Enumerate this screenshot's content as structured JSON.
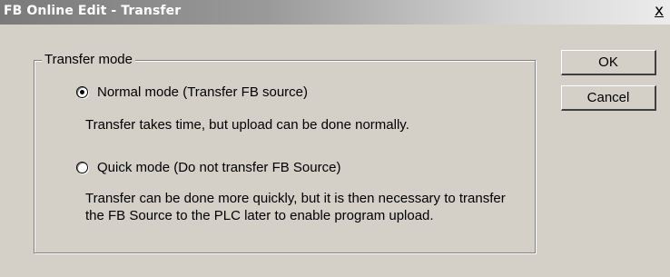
{
  "window": {
    "title": "FB Online Edit - Transfer",
    "close_label": "x"
  },
  "group": {
    "legend": "Transfer mode"
  },
  "options": [
    {
      "label": "Normal mode (Transfer FB source)",
      "description": "Transfer takes time, but upload can be done normally.",
      "checked": true
    },
    {
      "label": "Quick mode (Do not transfer FB Source)",
      "description_line1": "Transfer can be done more quickly, but it is then necessary to transfer",
      "description_line2": "the FB Source to the PLC later to enable program upload.",
      "checked": false
    }
  ],
  "buttons": {
    "ok_label": "OK",
    "cancel_label": "Cancel"
  }
}
